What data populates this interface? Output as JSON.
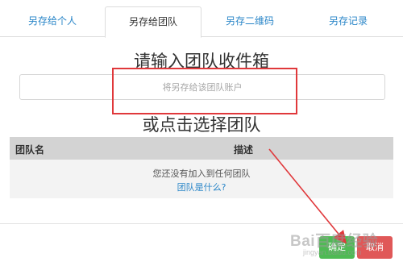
{
  "tabs": [
    {
      "label": "另存给个人"
    },
    {
      "label": "另存给团队"
    },
    {
      "label": "另存二维码"
    },
    {
      "label": "另存记录"
    }
  ],
  "active_tab": "另存给团队",
  "main": {
    "heading": "请输入团队收件箱",
    "input_placeholder": "将另存给该团队账户",
    "choose_heading": "或点击选择团队"
  },
  "table": {
    "columns": [
      "团队名",
      "描述"
    ],
    "empty_message": "您还没有加入到任何团队",
    "help_link": "团队是什么?"
  },
  "footer": {
    "confirm_label": "确定",
    "cancel_label": "取消"
  },
  "watermark": {
    "brand": "Bai百度经验",
    "sub": "jingyan.baidu.com"
  },
  "colors": {
    "link": "#2a86c8",
    "highlight": "#e0383b",
    "confirm": "#4fba54",
    "cancel": "#e05858",
    "table_header": "#d3d3d3"
  }
}
